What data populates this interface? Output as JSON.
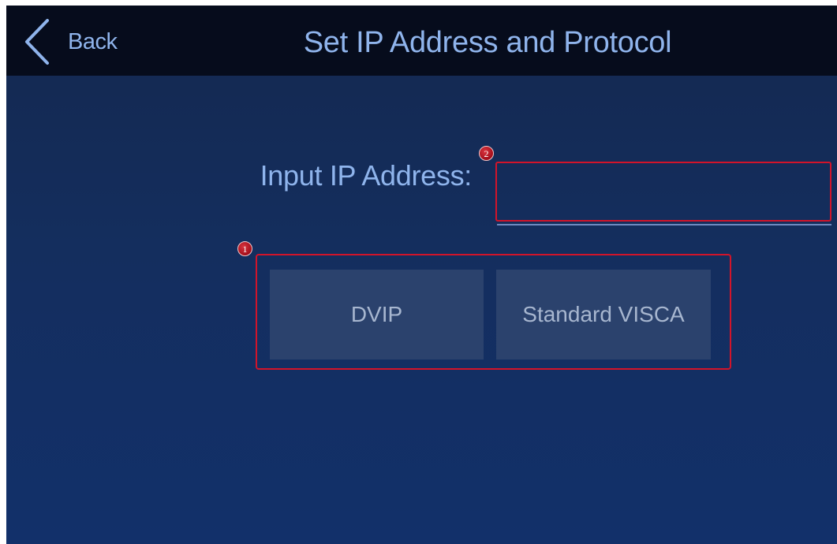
{
  "header": {
    "back_label": "Back",
    "title": "Set IP Address and Protocol"
  },
  "ip_form": {
    "label": "Input IP Address:",
    "value": ""
  },
  "protocols": {
    "dvip_label": "DVIP",
    "visca_label": "Standard VISCA"
  },
  "annotations": {
    "marker_1": "1",
    "marker_2": "2"
  },
  "colors": {
    "header_bg": "#060c1c",
    "screen_bg": "#142e5e",
    "text_accent": "#8fb4ec",
    "button_bg": "#2b426d",
    "button_text": "#a7b6cf",
    "annotation_red": "#d2142a"
  },
  "icons": {
    "back": "chevron-left-icon"
  }
}
